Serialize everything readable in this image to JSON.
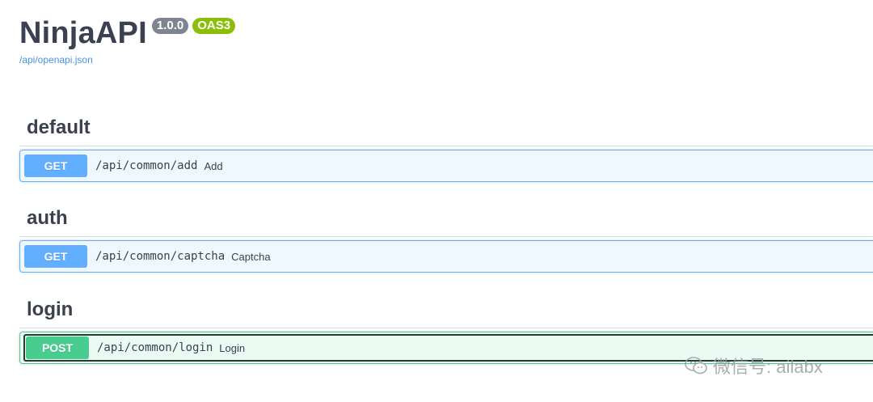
{
  "info": {
    "title": "NinjaAPI",
    "version": "1.0.0",
    "oas_badge": "OAS3",
    "spec_link": "/api/openapi.json"
  },
  "sections": [
    {
      "tag": "default",
      "method": "GET",
      "path": "/api/common/add",
      "summary": "Add"
    },
    {
      "tag": "auth",
      "method": "GET",
      "path": "/api/common/captcha",
      "summary": "Captcha"
    },
    {
      "tag": "login",
      "method": "POST",
      "path": "/api/common/login",
      "summary": "Login"
    }
  ],
  "watermark": "微信号: ailabx",
  "colors": {
    "get": "#61affe",
    "post": "#49cc90",
    "version_badge": "#7d8492",
    "oas_badge": "#89bf04",
    "link": "#4990e2"
  }
}
